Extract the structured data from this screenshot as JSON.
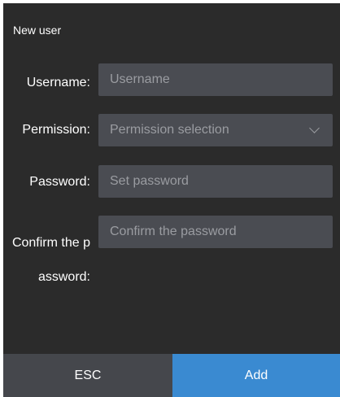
{
  "dialog": {
    "title": "New user"
  },
  "form": {
    "username": {
      "label": "Username:",
      "placeholder": "Username",
      "value": ""
    },
    "permission": {
      "label": "Permission:",
      "placeholder": "Permission selection"
    },
    "password": {
      "label": "Password:",
      "placeholder": "Set password",
      "value": ""
    },
    "confirm": {
      "label": "Confirm the password:",
      "placeholder": "Confirm the password",
      "value": ""
    }
  },
  "footer": {
    "esc_label": "ESC",
    "add_label": "Add"
  },
  "colors": {
    "background": "#2b2b2b",
    "field": "#4a4c52",
    "primary": "#3a8ad1",
    "secondary": "#45474c"
  },
  "icons": {
    "permission_dropdown": "chevron-down-icon"
  }
}
